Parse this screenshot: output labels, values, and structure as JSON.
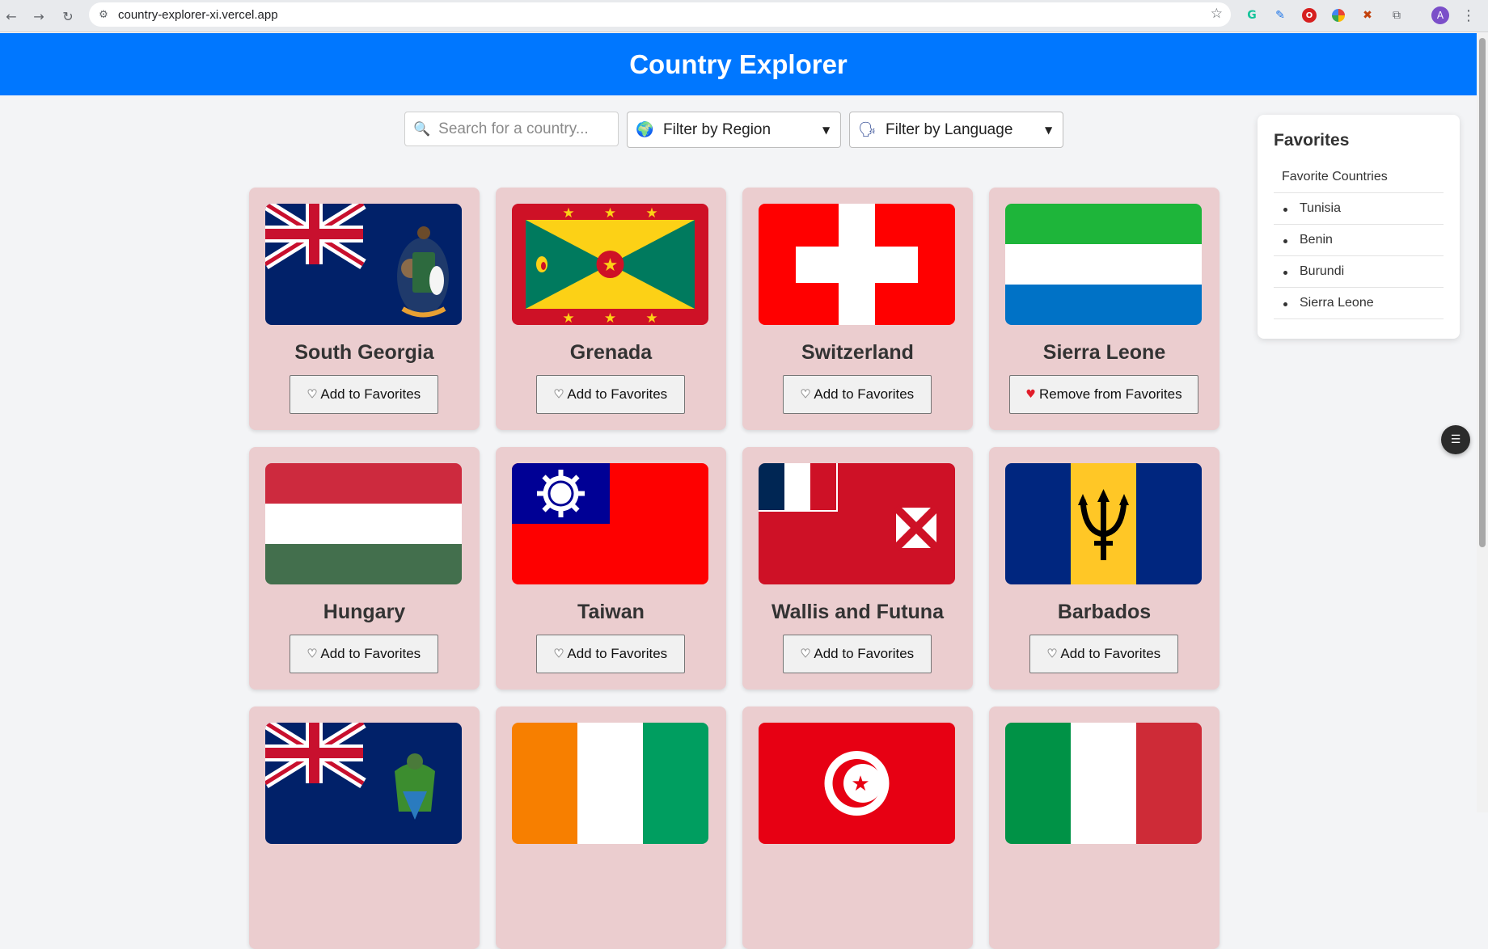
{
  "browser": {
    "url": "country-explorer-xi.vercel.app",
    "profile_initial": "A"
  },
  "header": {
    "title": "Country Explorer"
  },
  "controls": {
    "search_placeholder": "Search for a country...",
    "region_label": "Filter by Region",
    "language_label": "Filter by Language"
  },
  "countries": [
    {
      "name": "South Georgia",
      "button": "Add to Favorites",
      "favorite": false
    },
    {
      "name": "Grenada",
      "button": "Add to Favorites",
      "favorite": false
    },
    {
      "name": "Switzerland",
      "button": "Add to Favorites",
      "favorite": false
    },
    {
      "name": "Sierra Leone",
      "button": "Remove from Favorites",
      "favorite": true
    },
    {
      "name": "Hungary",
      "button": "Add to Favorites",
      "favorite": false
    },
    {
      "name": "Taiwan",
      "button": "Add to Favorites",
      "favorite": false
    },
    {
      "name": "Wallis and Futuna",
      "button": "Add to Favorites",
      "favorite": false
    },
    {
      "name": "Barbados",
      "button": "Add to Favorites",
      "favorite": false
    }
  ],
  "favorites": {
    "title": "Favorites",
    "subtitle": "Favorite Countries",
    "items": [
      "Tunisia",
      "Benin",
      "Burundi",
      "Sierra Leone"
    ]
  },
  "colors": {
    "header_bg": "#0077ff",
    "card_bg": "#ebcdcf",
    "page_bg": "#f3f4f6"
  },
  "icons": {
    "search": "magnifier-icon",
    "region": "globe-icon",
    "language": "speaking-head-icon",
    "add_favorite": "white-heart-icon",
    "remove_favorite": "red-heart-icon"
  }
}
